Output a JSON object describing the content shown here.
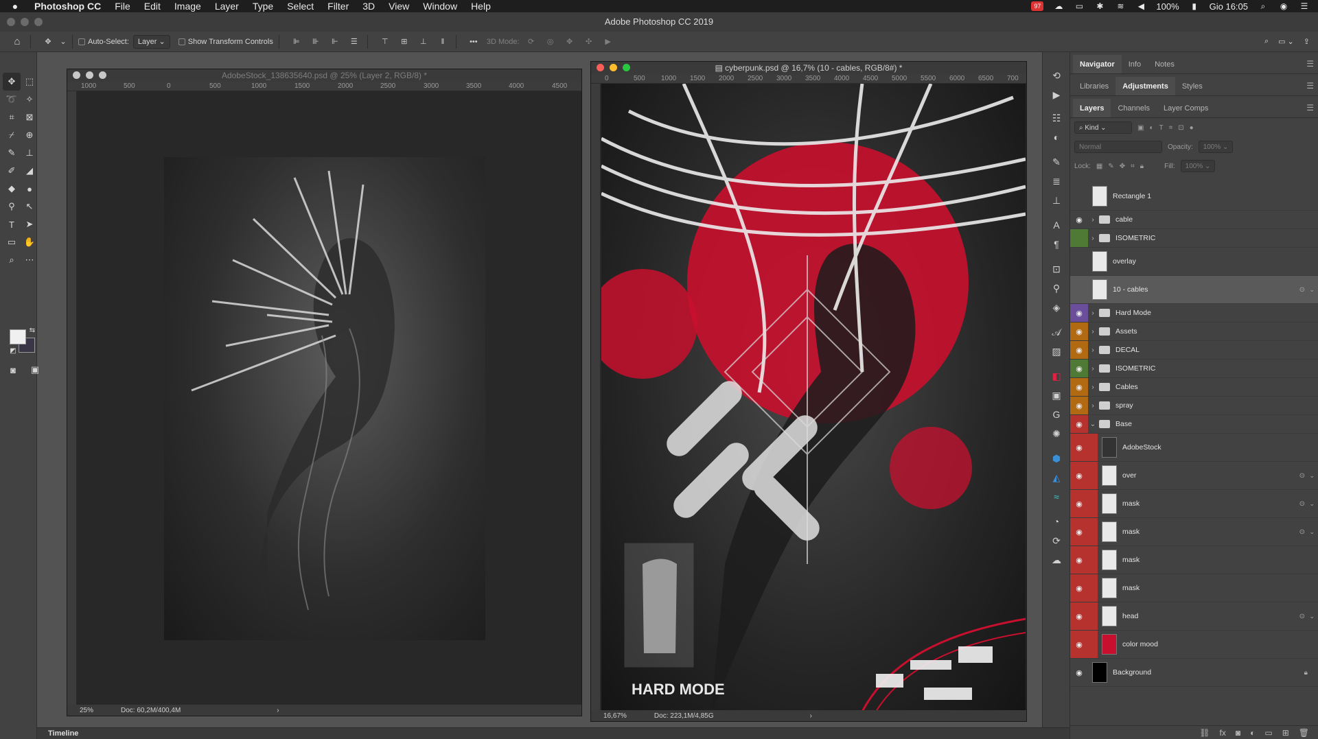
{
  "menubar": {
    "app_name": "Photoshop CC",
    "items": [
      "File",
      "Edit",
      "Image",
      "Layer",
      "Type",
      "Select",
      "Filter",
      "3D",
      "View",
      "Window",
      "Help"
    ],
    "battery": "100%",
    "clock": "Gio 16:05",
    "notif_badge": "97"
  },
  "window": {
    "title": "Adobe Photoshop CC 2019"
  },
  "options": {
    "auto_select_label": "Auto-Select:",
    "auto_select_value": "Layer",
    "transform_label": "Show Transform Controls",
    "mode3d_label": "3D Mode:"
  },
  "doc1": {
    "title": "AdobeStock_138635640.psd @ 25% (Layer 2, RGB/8) *",
    "zoom": "25%",
    "doc_info": "Doc: 60,2M/400,4M",
    "ruler": [
      "1000",
      "500",
      "0",
      "500",
      "1000",
      "1500",
      "2000",
      "2500",
      "3000",
      "3500",
      "4000",
      "4500"
    ]
  },
  "doc2": {
    "title": "cyberpunk.psd @ 16,7% (10 - cables, RGB/8#) *",
    "zoom": "16,67%",
    "doc_info": "Doc: 223,1M/4,85G",
    "ruler": [
      "0",
      "500",
      "1000",
      "1500",
      "2000",
      "2500",
      "3000",
      "3500",
      "4000",
      "4500",
      "5000",
      "5500",
      "6000",
      "6500",
      "700"
    ],
    "poster_text": "HARD MODE"
  },
  "panels": {
    "tabs_row1": [
      "Navigator",
      "Info",
      "Notes"
    ],
    "tabs_row2": [
      "Libraries",
      "Adjustments",
      "Styles"
    ],
    "tabs_row3": [
      "Layers",
      "Channels",
      "Layer Comps"
    ],
    "kind": "Kind",
    "blend": "Normal",
    "opacity_label": "Opacity:",
    "opacity": "100%",
    "lock_label": "Lock:",
    "fill_label": "Fill:",
    "fill": "100%"
  },
  "layers": [
    {
      "name": "Rectangle 1",
      "type": "thumb",
      "color": "",
      "visible": false
    },
    {
      "name": "cable",
      "type": "folder",
      "color": "",
      "visible": true
    },
    {
      "name": "ISOMETRIC",
      "type": "folder",
      "color": "#4f7a35",
      "visible": false
    },
    {
      "name": "overlay",
      "type": "thumb",
      "color": "",
      "visible": false
    },
    {
      "name": "10 - cables",
      "type": "thumb",
      "color": "",
      "visible": false,
      "selected": true
    },
    {
      "name": "Hard Mode",
      "type": "folder",
      "color": "#6a4e9c",
      "visible": true
    },
    {
      "name": "Assets",
      "type": "folder",
      "color": "#b26a12",
      "visible": true
    },
    {
      "name": "DECAL",
      "type": "folder",
      "color": "#b26a12",
      "visible": true
    },
    {
      "name": "ISOMETRIC",
      "type": "folder",
      "color": "#4f7a35",
      "visible": true
    },
    {
      "name": "Cables",
      "type": "folder",
      "color": "#b26a12",
      "visible": true
    },
    {
      "name": "spray",
      "type": "folder",
      "color": "#b26a12",
      "visible": true
    },
    {
      "name": "Base",
      "type": "folder-open",
      "color": "#b5322e",
      "visible": true
    },
    {
      "name": "AdobeStock",
      "type": "thumb",
      "color": "#b5322e",
      "visible": true
    },
    {
      "name": "over",
      "type": "thumb",
      "color": "#b5322e",
      "visible": true
    },
    {
      "name": "mask",
      "type": "thumb",
      "color": "#b5322e",
      "visible": true
    },
    {
      "name": "mask",
      "type": "thumb",
      "color": "#b5322e",
      "visible": true
    },
    {
      "name": "mask",
      "type": "thumb",
      "color": "#b5322e",
      "visible": true
    },
    {
      "name": "mask",
      "type": "thumb",
      "color": "#b5322e",
      "visible": true
    },
    {
      "name": "head",
      "type": "thumb",
      "color": "#b5322e",
      "visible": true
    },
    {
      "name": "color mood",
      "type": "thumb",
      "color": "#b5322e",
      "visible": true
    },
    {
      "name": "Background",
      "type": "thumb",
      "color": "",
      "visible": true
    }
  ],
  "timeline": {
    "label": "Timeline"
  },
  "colors": {
    "accent_red": "#c8102e",
    "panel": "#424242",
    "canvas": "#282828"
  }
}
